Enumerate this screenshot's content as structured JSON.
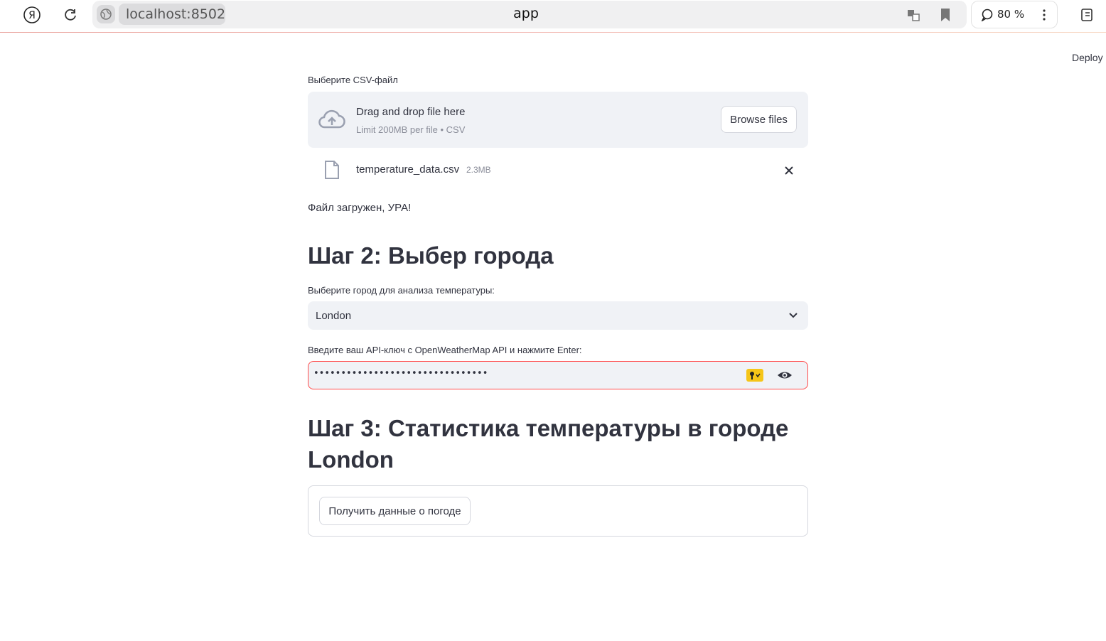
{
  "browser": {
    "url": "localhost:8502",
    "tab_title": "app",
    "zoom": "80 %"
  },
  "header": {
    "deploy_label": "Deploy"
  },
  "upload": {
    "label": "Выберите CSV-файл",
    "drop_title": "Drag and drop file here",
    "drop_subtitle": "Limit 200MB per file • CSV",
    "browse_label": "Browse files",
    "file_name": "temperature_data.csv",
    "file_size": "2.3MB",
    "success_text": "Файл загружен, УРА!"
  },
  "step2": {
    "heading": "Шаг 2: Выбер города",
    "city_label": "Выберите город для анализа температуры:",
    "city_value": "London",
    "api_label": "Введите ваш API-ключ с OpenWeatherMap API и нажмите Enter:",
    "api_value_masked": "••••••••••••••••••••••••••••••••"
  },
  "step3": {
    "heading_line1": "Шаг 3: Статистика температуры в городе",
    "heading_line2": "London",
    "weather_button_label": "Получить данные о погоде"
  },
  "colors": {
    "accent_red": "#ff4b4b",
    "input_bg": "#f0f2f6",
    "text": "#31333f",
    "key_badge": "#f5c518"
  },
  "icons": {
    "yandex": "yandex-logo-icon",
    "reload": "reload-icon",
    "site": "globe-icon",
    "translate": "translate-icon",
    "bookmark": "bookmark-icon",
    "comment": "comment-icon",
    "menu": "more-vertical-icon",
    "sidebar": "sidebar-panel-icon",
    "upload": "cloud-upload-icon",
    "file": "file-icon",
    "close": "close-icon",
    "chevron": "chevron-down-icon",
    "key": "key-icon",
    "eye": "eye-icon"
  }
}
